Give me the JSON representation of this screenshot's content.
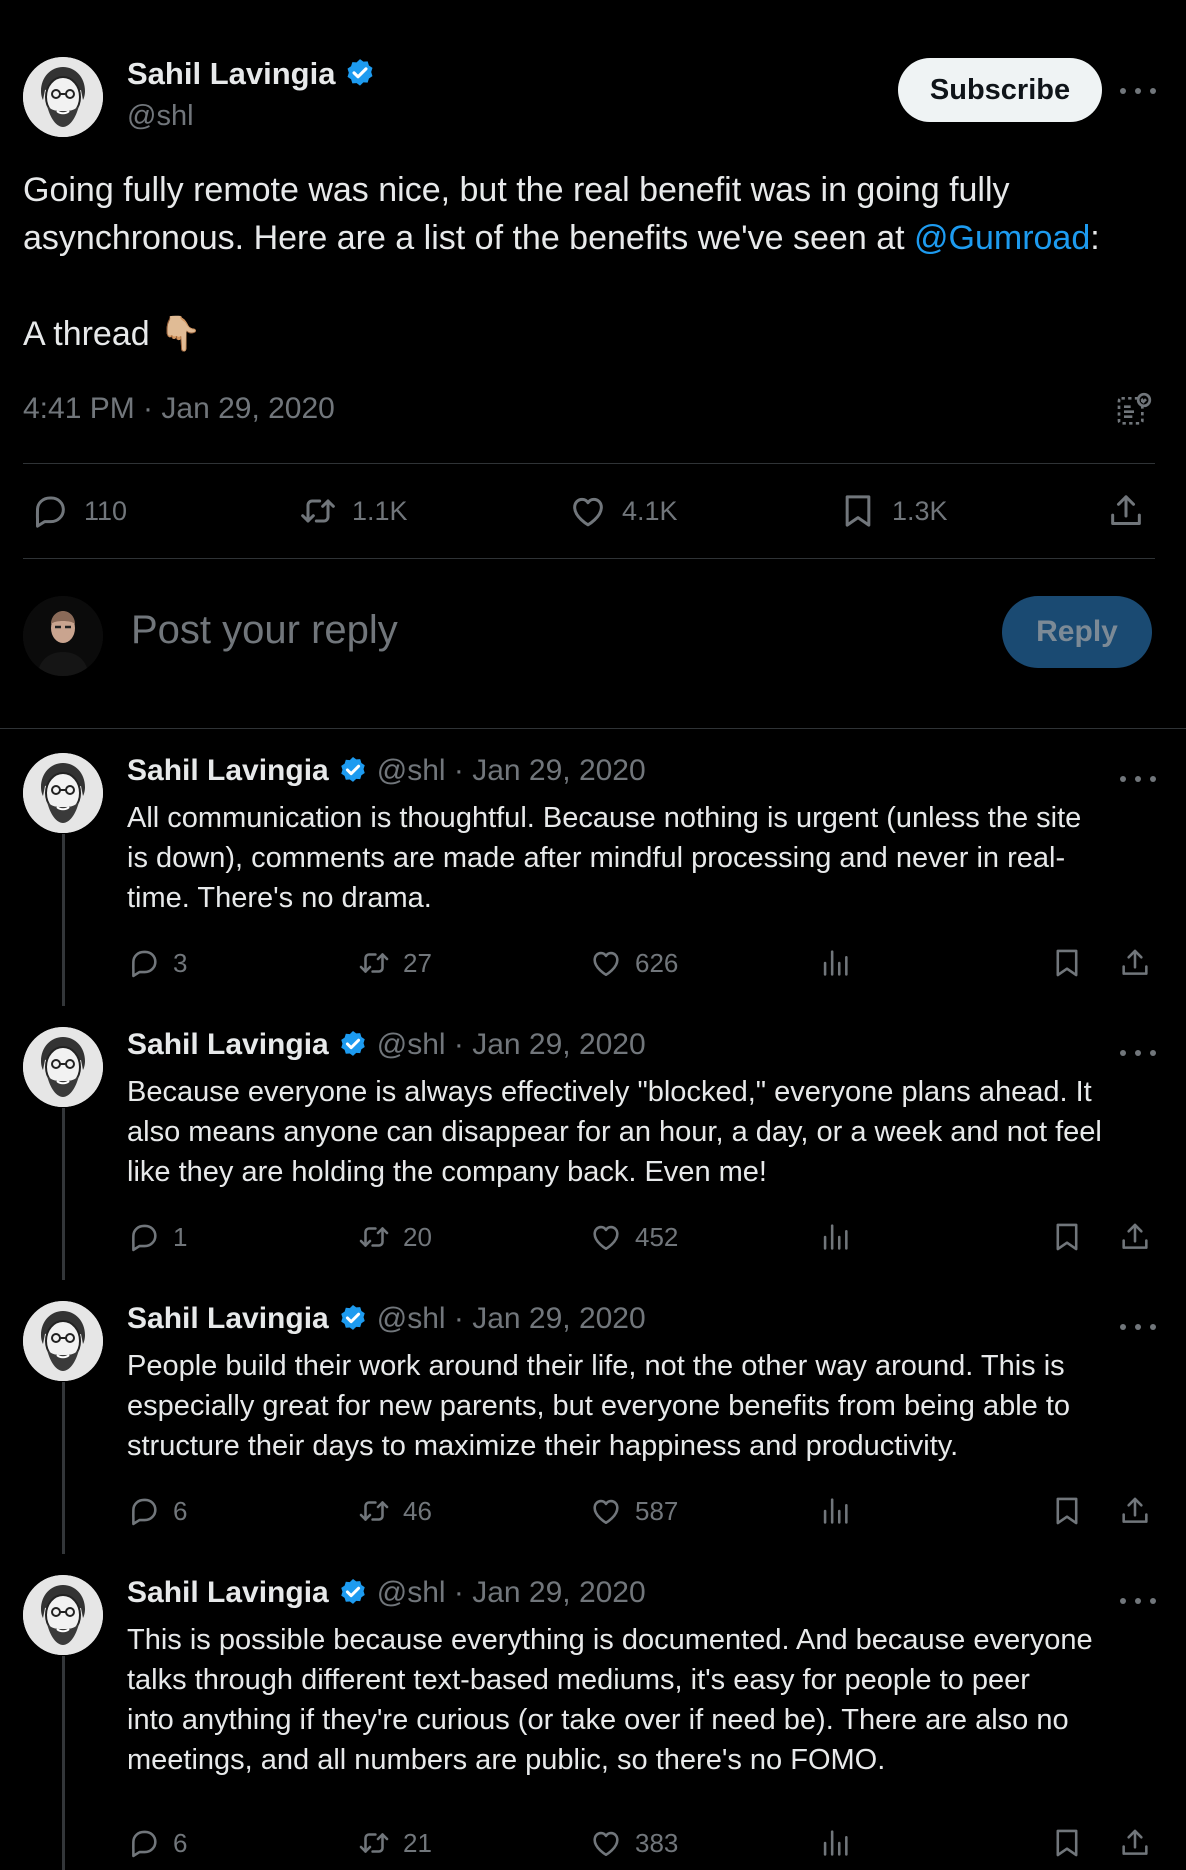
{
  "main_tweet": {
    "author_name": "Sahil Lavingia",
    "author_handle": "@shl",
    "subscribe_label": "Subscribe",
    "text_line1": "Going fully remote was nice, but the real benefit was in going fully",
    "text_line2_prefix": "asynchronous. Here are a list of the benefits we've seen at ",
    "mention": "@Gumroad",
    "text_line2_suffix": ":",
    "text_line3": "A thread",
    "thread_emoji": "👇🏼",
    "timestamp": "4:41 PM · Jan 29, 2020",
    "stats": {
      "replies": "110",
      "retweets": "1.1K",
      "likes": "4.1K",
      "bookmarks": "1.3K"
    }
  },
  "reply_composer": {
    "placeholder": "Post your reply",
    "button_label": "Reply"
  },
  "thread": [
    {
      "author_name": "Sahil Lavingia",
      "handle_date": "@shl · Jan 29, 2020",
      "lines": [
        "All communication is thoughtful. Because nothing is urgent (unless the site",
        "is down), comments are made after mindful processing and never in real-",
        "time. There's no drama."
      ],
      "replies": "3",
      "retweets": "27",
      "likes": "626"
    },
    {
      "author_name": "Sahil Lavingia",
      "handle_date": "@shl · Jan 29, 2020",
      "lines": [
        "Because everyone is always effectively \"blocked,\" everyone plans ahead. It",
        "also means anyone can disappear for an hour, a day, or a week and not feel",
        "like they are holding the company back. Even me!"
      ],
      "replies": "1",
      "retweets": "20",
      "likes": "452"
    },
    {
      "author_name": "Sahil Lavingia",
      "handle_date": "@shl · Jan 29, 2020",
      "lines": [
        "People build their work around their life, not the other way around. This is",
        "especially great for new parents, but everyone benefits from being able to",
        "structure their days to maximize their happiness and productivity."
      ],
      "replies": "6",
      "retweets": "46",
      "likes": "587"
    },
    {
      "author_name": "Sahil Lavingia",
      "handle_date": "@shl · Jan 29, 2020",
      "lines": [
        "This is possible because everything is documented. And because everyone",
        "talks through different text-based mediums, it's easy for people to peer",
        "into anything if they're curious (or take over if need be). There are also no",
        "meetings, and all numbers are public, so there's no FOMO."
      ],
      "replies": "6",
      "retweets": "21",
      "likes": "383"
    }
  ],
  "colors": {
    "background": "#000000",
    "text": "#e7e9ea",
    "muted": "#71767b",
    "accent": "#1d9bf0",
    "divider": "#2f3336"
  },
  "icons": [
    "verified-badge-icon",
    "more-icon",
    "reply-icon",
    "retweet-icon",
    "like-icon",
    "bookmark-icon",
    "share-icon",
    "views-icon",
    "grok-icon"
  ]
}
